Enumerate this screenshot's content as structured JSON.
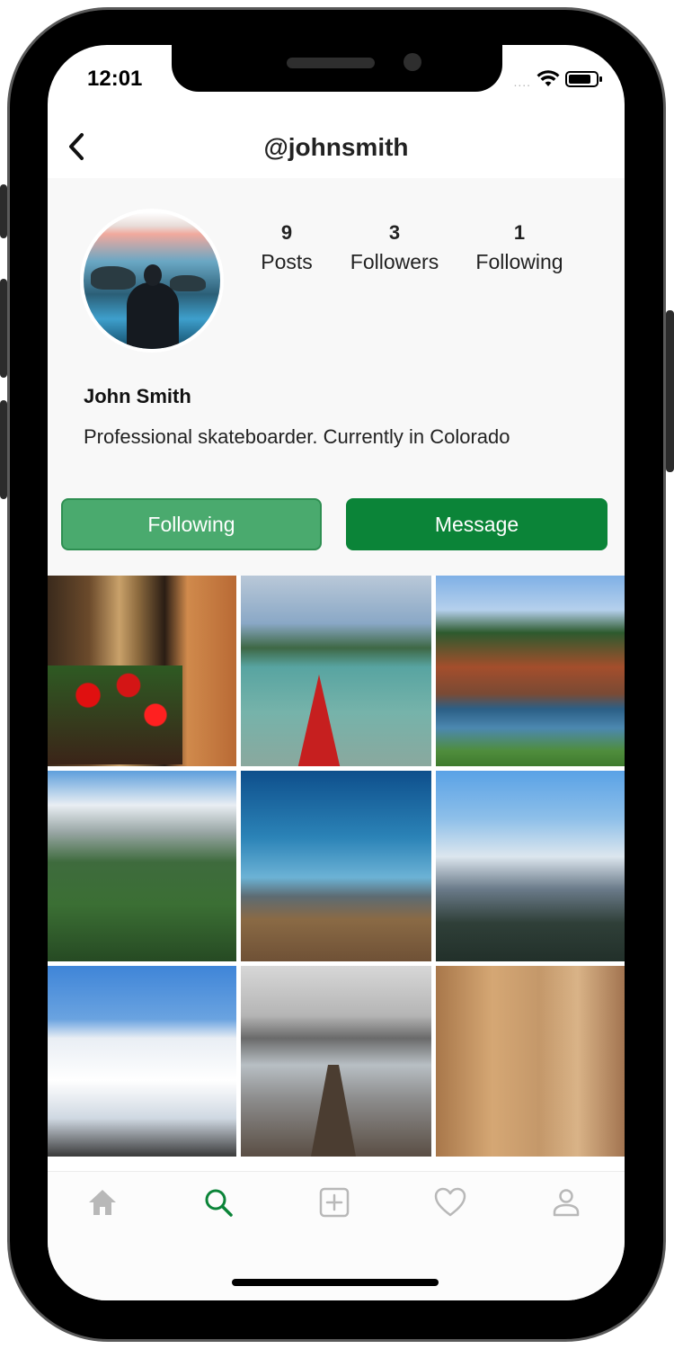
{
  "status_bar": {
    "time": "12:01",
    "signal": "....",
    "wifi_icon": "wifi-icon",
    "battery_icon": "battery-icon"
  },
  "header": {
    "title": "@johnsmith",
    "back_icon": "chevron-left-icon"
  },
  "profile": {
    "stats": [
      {
        "value": "9",
        "label": "Posts"
      },
      {
        "value": "3",
        "label": "Followers"
      },
      {
        "value": "1",
        "label": "Following"
      }
    ],
    "name": "John Smith",
    "bio": "Professional skateboarder. Currently in Colorado",
    "following_button": "Following",
    "message_button": "Message"
  },
  "grid": {
    "tile_count": 9
  },
  "tabbar": {
    "items": [
      "home-icon",
      "search-icon",
      "add-post-icon",
      "heart-icon",
      "profile-icon"
    ],
    "active": "search-icon"
  },
  "colors": {
    "accent": "#0b8438",
    "following_button": "#4aaa6e",
    "tab_inactive": "#b8b8b8",
    "tab_active": "#0b8438"
  }
}
